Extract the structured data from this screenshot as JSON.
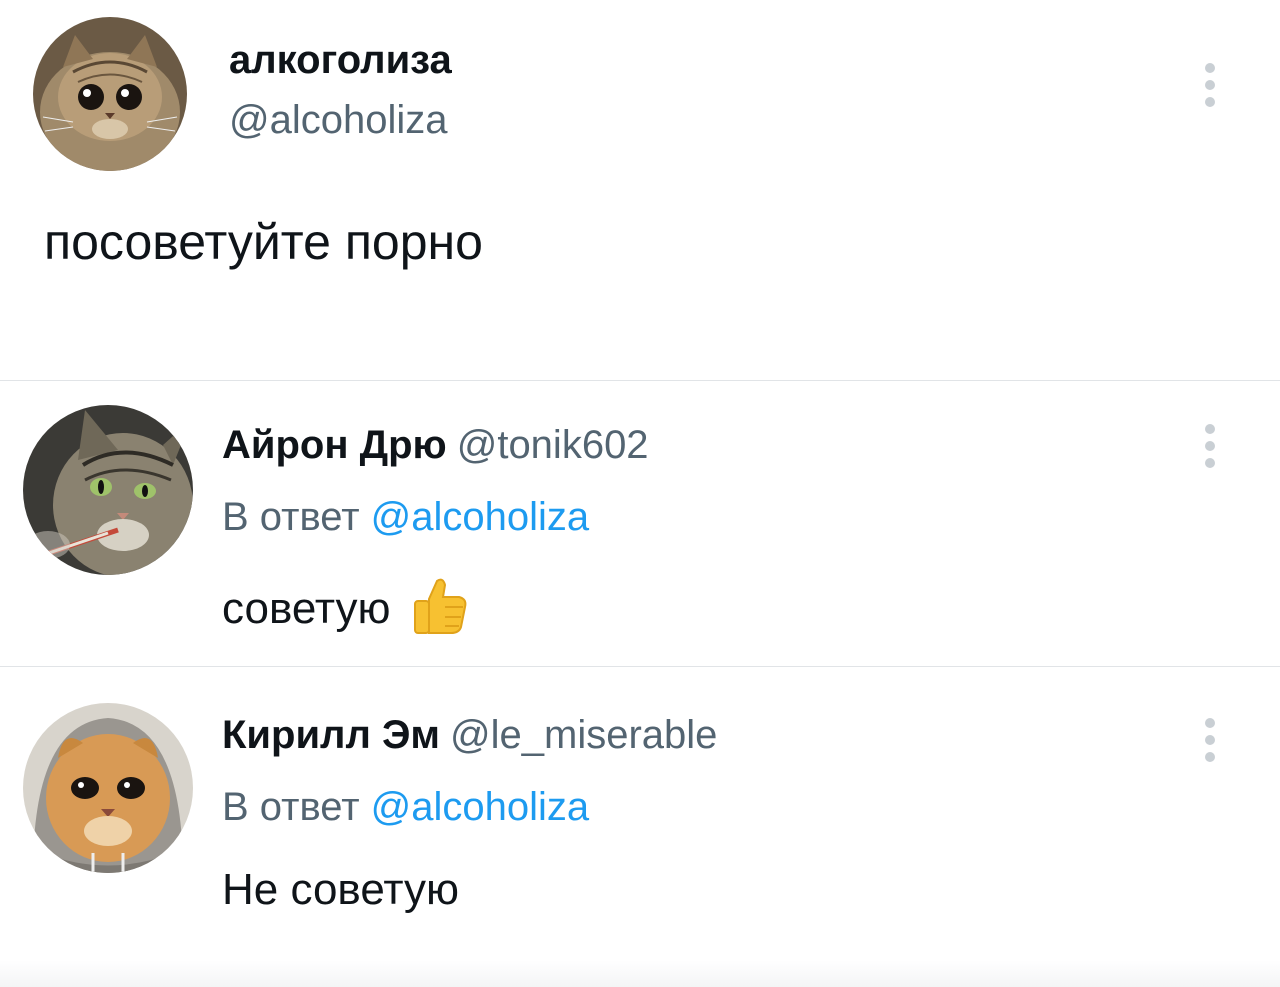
{
  "main_tweet": {
    "display_name": "алкоголиза",
    "handle": "@alcoholiza",
    "text": "посоветуйте порно",
    "avatar_icon": "cat-avatar-icon",
    "more_icon": "more-options-icon"
  },
  "replies": [
    {
      "display_name": "Айрон Дрю",
      "handle": "@tonik602",
      "reply_prefix": "В ответ",
      "reply_mention": "@alcoholiza",
      "text": "советую",
      "emoji": "thumbs-up-icon",
      "avatar_icon": "cat-avatar-icon",
      "more_icon": "more-options-icon"
    },
    {
      "display_name": "Кирилл Эм",
      "handle": "@le_miserable",
      "reply_prefix": "В ответ",
      "reply_mention": "@alcoholiza",
      "text": "Не советую",
      "avatar_icon": "cat-avatar-icon",
      "more_icon": "more-options-icon"
    }
  ],
  "colors": {
    "text": "#0f1419",
    "secondary": "#536471",
    "accent": "#1d9bf0",
    "divider": "#e1e4e7"
  }
}
